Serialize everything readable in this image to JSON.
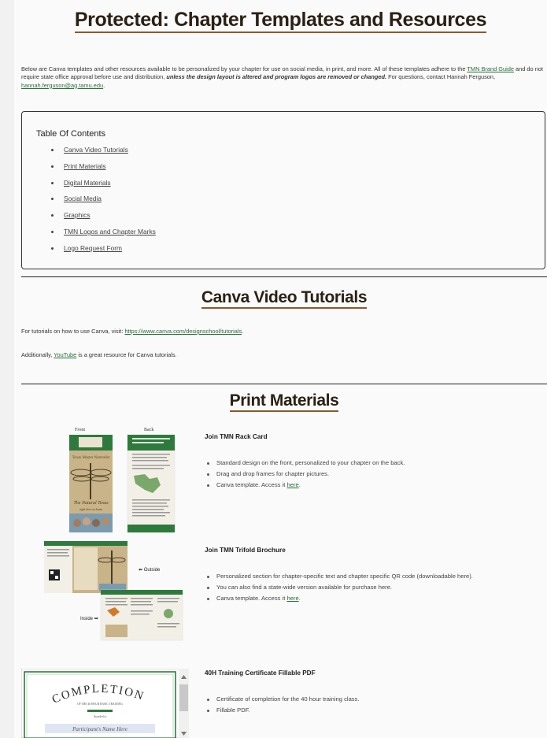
{
  "page_title": "Protected: Chapter Templates and Resources",
  "intro": {
    "part1": "Below are Canva templates and other resources available to be personalized by your chapter for use on social media, in print, and more. All of these templates adhere to the ",
    "brand_link": "TMN Brand Guide",
    "part2": " and do not require state office approval before use and distribution, ",
    "emphasis": "unless the design layout is altered and program logos are removed or changed.",
    "part3": " For questions, contact Hannah Ferguson, ",
    "email": "hannah.ferguson@ag.tamu.edu",
    "part4": "."
  },
  "toc": {
    "title": "Table Of Contents",
    "items": [
      "Canva Video Tutorials",
      "Print Materials",
      "Digital Materials",
      "Social Media",
      "Graphics",
      "TMN Logos and Chapter Marks",
      "Logo Request Form"
    ]
  },
  "canva": {
    "heading": "Canva Video Tutorials",
    "line1_prefix": "For tutorials on how to use Canva, visit: ",
    "line1_link": "https://www.canva.com/designschool/tutorials",
    "line1_suffix": ".",
    "line2_prefix": "Additionally, ",
    "line2_link": "YouTube",
    "line2_suffix": " is a great resource for Canva tutorials."
  },
  "print": {
    "heading": "Print Materials",
    "items": [
      {
        "title": "Join TMN Rack Card",
        "bullets": [
          {
            "text": "Standard design on the front, personalized to your chapter on the back."
          },
          {
            "text": "Drag and drop frames for chapter pictures."
          },
          {
            "text": "Canva template. Access it ",
            "link": "here",
            "suffix": "."
          }
        ],
        "image_labels": {
          "front": "Front",
          "back": "Back",
          "card_name": "Texas Master Naturalist",
          "card_tagline": "The Natural Texas",
          "card_sub": "right here at home"
        }
      },
      {
        "title": "Join TMN Trifold Brochure",
        "bullets": [
          {
            "text": "Personalized section for chapter-specific text and chapter specific QR code (downloadable here)."
          },
          {
            "text": "You can also find a state-wide version available for purchase here."
          },
          {
            "text": "Canva template. Access it ",
            "link": "here",
            "suffix": "."
          }
        ],
        "image_labels": {
          "outside": "Outside",
          "inside": "Inside"
        }
      },
      {
        "title": "40H Training Certificate Fillable PDF",
        "bullets": [
          {
            "text": "Certificate of completion for the 40 hour training class."
          },
          {
            "text": "Fillable PDF."
          }
        ],
        "image_labels": {
          "completion": "COMPLETION",
          "of_this": "OF THE 40 HOUR BASIC TRAINING",
          "awarded": "Awarded to",
          "name_placeholder": "Participant's Name Here"
        }
      }
    ]
  },
  "colors": {
    "accent_green": "#2a6b3a",
    "heading_underline": "#8a5a2a",
    "tmn_green": "#2d7a3c",
    "tan": "#c9b48a"
  }
}
